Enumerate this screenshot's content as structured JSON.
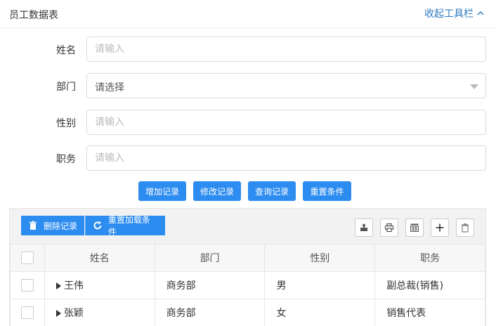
{
  "header": {
    "title": "员工数据表",
    "collapse_label": "收起工具栏"
  },
  "form": {
    "name": {
      "label": "姓名",
      "placeholder": "请输入"
    },
    "department": {
      "label": "部门",
      "placeholder": "请选择"
    },
    "gender": {
      "label": "性别",
      "placeholder": "请输入"
    },
    "position": {
      "label": "职务",
      "placeholder": "请输入"
    }
  },
  "actions": {
    "add": "增加记录",
    "edit": "修改记录",
    "query": "查询记录",
    "reset": "重置条件"
  },
  "toolbar": {
    "delete": "删除记录",
    "reload": "重置加载条件",
    "icons": [
      "export-icon",
      "print-icon",
      "columns-icon",
      "add-icon",
      "trash-icon"
    ]
  },
  "table": {
    "columns": [
      "姓名",
      "部门",
      "性别",
      "职务"
    ],
    "rows": [
      {
        "name": "王伟",
        "dept": "商务部",
        "gender": "男",
        "position": "副总裁(销售)"
      },
      {
        "name": "张颖",
        "dept": "商务部",
        "gender": "女",
        "position": "销售代表"
      }
    ]
  },
  "colors": {
    "primary": "#2d8cf0",
    "link": "#2f7bc1"
  }
}
